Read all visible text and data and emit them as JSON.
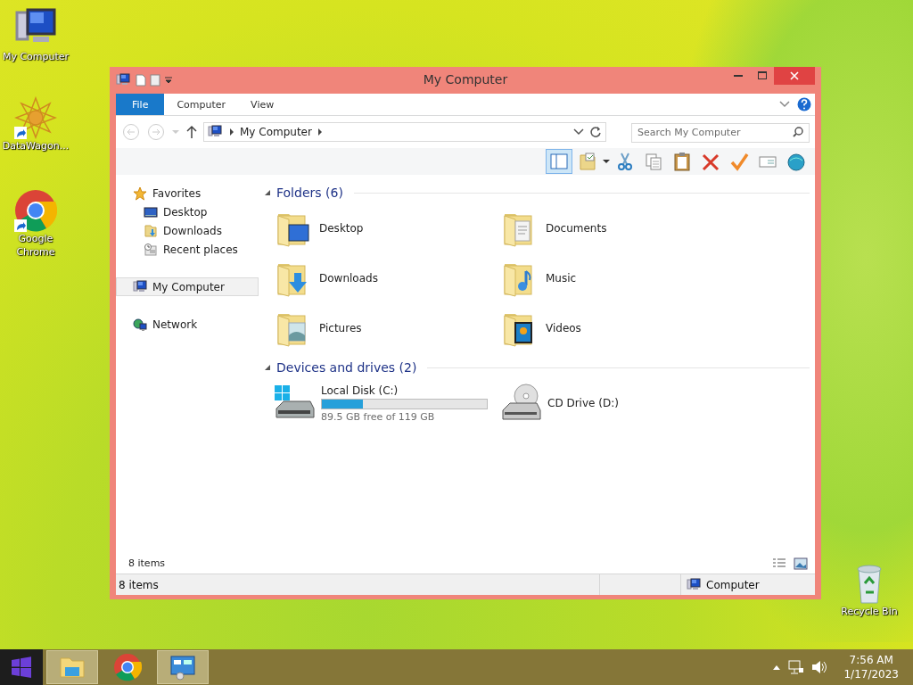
{
  "desktop_icons": [
    {
      "label": "My Computer",
      "kind": "computer",
      "shortcut": false
    },
    {
      "label": "DataWagon...",
      "kind": "app",
      "shortcut": true
    },
    {
      "label": "Google Chrome",
      "kind": "chrome",
      "shortcut": true
    }
  ],
  "recycle_bin": {
    "label": "Recycle Bin"
  },
  "window": {
    "title": "My Computer",
    "ribbon_tabs": [
      {
        "label": "File",
        "selected": true
      },
      {
        "label": "Computer",
        "selected": false
      },
      {
        "label": "View",
        "selected": false
      }
    ],
    "address": {
      "path": "My Computer"
    },
    "search": {
      "placeholder": "Search My Computer"
    },
    "preview_pane": {
      "on": true
    },
    "toolbar_buttons": [
      {
        "kind": "properties"
      },
      {
        "kind": "cut"
      },
      {
        "kind": "copy"
      },
      {
        "kind": "paste"
      },
      {
        "kind": "delete"
      },
      {
        "kind": "check"
      },
      {
        "kind": "rename"
      },
      {
        "kind": "globe"
      }
    ],
    "nav": [
      {
        "label": "Favorites",
        "kind": "favorites",
        "selected": false,
        "children": [
          {
            "label": "Desktop",
            "kind": "desktop",
            "selected": false
          },
          {
            "label": "Downloads",
            "kind": "downloads",
            "selected": false
          },
          {
            "label": "Recent places",
            "kind": "recent",
            "selected": false
          }
        ]
      },
      {
        "label": "My Computer",
        "kind": "computer",
        "selected": true
      },
      {
        "label": "Network",
        "kind": "network",
        "selected": false
      }
    ],
    "sections": [
      {
        "title": "Folders (6)",
        "items": [
          {
            "label": "Desktop",
            "kind": "desktop"
          },
          {
            "label": "Documents",
            "kind": "documents"
          },
          {
            "label": "Downloads",
            "kind": "downloads"
          },
          {
            "label": "Music",
            "kind": "music"
          },
          {
            "label": "Pictures",
            "kind": "pictures"
          },
          {
            "label": "Videos",
            "kind": "videos"
          }
        ]
      },
      {
        "title": "Devices and drives (2)",
        "items": [
          {
            "label": "Local Disk (C:)",
            "kind": "disk",
            "level": 0.25,
            "free": "89.5 GB free of 119 GB"
          },
          {
            "label": "CD Drive (D:)",
            "kind": "cd"
          }
        ]
      }
    ],
    "item_count": "8 items",
    "status_bar": {
      "left": "8 items",
      "right": "Computer"
    }
  },
  "taskbar": {
    "apps": [
      {
        "kind": "explorer",
        "selected": true
      },
      {
        "kind": "chrome",
        "selected": false
      },
      {
        "kind": "control",
        "selected": true
      }
    ],
    "time": "7:56 AM",
    "date": "1/17/2023"
  }
}
